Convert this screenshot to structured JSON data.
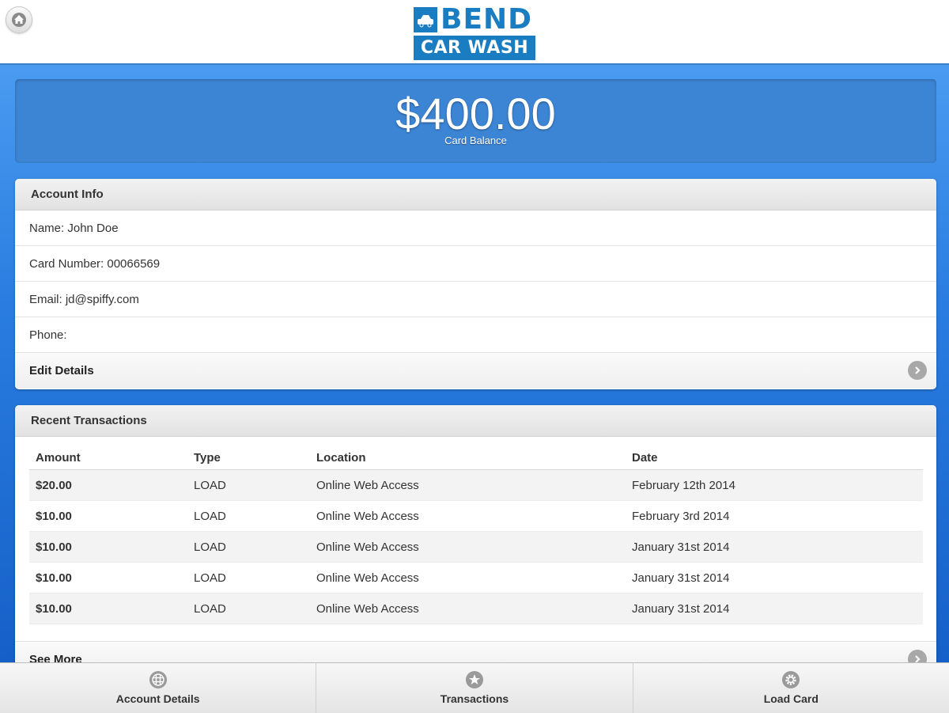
{
  "header": {
    "home_icon": "home-icon",
    "logo": {
      "top_word": "BEND",
      "bottom_word": "CAR WASH",
      "color": "#1a7dc1"
    }
  },
  "balance": {
    "amount": "$400.00",
    "label": "Card Balance"
  },
  "account_info": {
    "title": "Account Info",
    "rows": [
      "Name: John Doe",
      "Card Number: 00066569",
      "Email: jd@spiffy.com",
      "Phone:"
    ],
    "edit_label": "Edit Details"
  },
  "transactions": {
    "title": "Recent Transactions",
    "columns": [
      "Amount",
      "Type",
      "Location",
      "Date"
    ],
    "rows": [
      [
        "$20.00",
        "LOAD",
        "Online Web Access",
        "February 12th 2014"
      ],
      [
        "$10.00",
        "LOAD",
        "Online Web Access",
        "February 3rd 2014"
      ],
      [
        "$10.00",
        "LOAD",
        "Online Web Access",
        "January 31st 2014"
      ],
      [
        "$10.00",
        "LOAD",
        "Online Web Access",
        "January 31st 2014"
      ],
      [
        "$10.00",
        "LOAD",
        "Online Web Access",
        "January 31st 2014"
      ]
    ],
    "see_more_label": "See More"
  },
  "navbar": {
    "items": [
      {
        "label": "Account Details",
        "icon": "grid-icon"
      },
      {
        "label": "Transactions",
        "icon": "star-icon"
      },
      {
        "label": "Load Card",
        "icon": "gear-icon"
      }
    ]
  },
  "colors": {
    "accent": "#1a7dc1",
    "background_blue": "#2a7de0",
    "balance_panel": "#3c84d4"
  }
}
